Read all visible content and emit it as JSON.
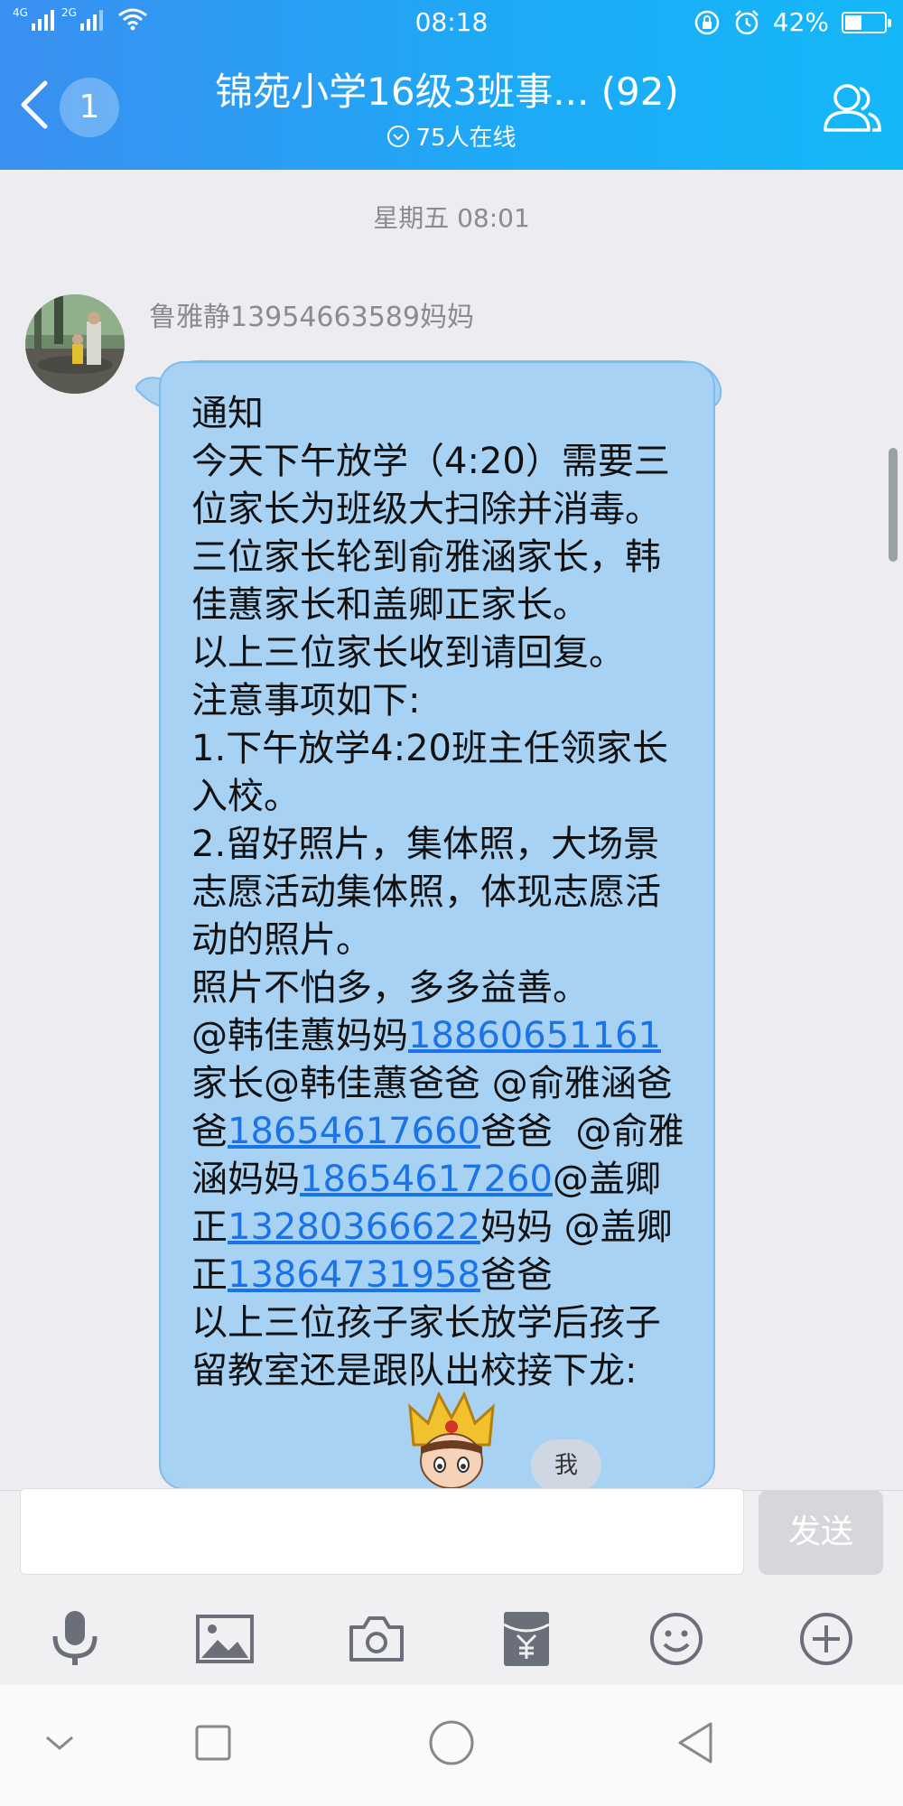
{
  "status_bar": {
    "net1": "4G",
    "net2": "2G",
    "time": "08:18",
    "battery_text": "42%",
    "battery_level": 0.42
  },
  "header": {
    "unread_count": "1",
    "title": "锦苑小学16级3班事... (92)",
    "online": "75人在线"
  },
  "chat": {
    "timestamp": "星期五 08:01",
    "sender": "鲁雅静13954663589妈妈",
    "message": {
      "p1": "通知\n今天下午放学（4:20）需要三位家长为班级大扫除并消毒。\n三位家长轮到俞雅涵家长，韩佳蕙家长和盖卿正家长。\n以上三位家长收到请回复。\n注意事项如下:\n1.下午放学4:20班主任领家长入校。\n2.留好照片，集体照，大场景志愿活动集体照，体现志愿活动的照片。\n照片不怕多，多多益善。\n@韩佳蕙妈妈",
      "phone1": "18860651161",
      "p2": "家长@韩佳蕙爸爸 @俞雅涵爸爸",
      "phone2": "18654617660",
      "p3": "爸爸  @俞雅涵妈妈",
      "phone3": "18654617260",
      "p4": "@盖卿正",
      "phone4": "13280366622",
      "p5": "妈妈 @盖卿正",
      "phone5": "13864731958",
      "p6": "爸爸\n以上三位孩子家长放学后孩子留教室还是跟队出校接下龙:"
    },
    "me_badge": "我"
  },
  "input": {
    "placeholder": "",
    "send_label": "发送"
  },
  "toolbar": [
    "microphone-icon",
    "image-icon",
    "camera-icon",
    "red-packet-icon",
    "emoji-icon",
    "plus-icon"
  ],
  "colors": {
    "header_start": "#3a8ff0",
    "header_end": "#14b8f8",
    "bubble": "#a8d2f4",
    "link": "#1a73e8"
  }
}
